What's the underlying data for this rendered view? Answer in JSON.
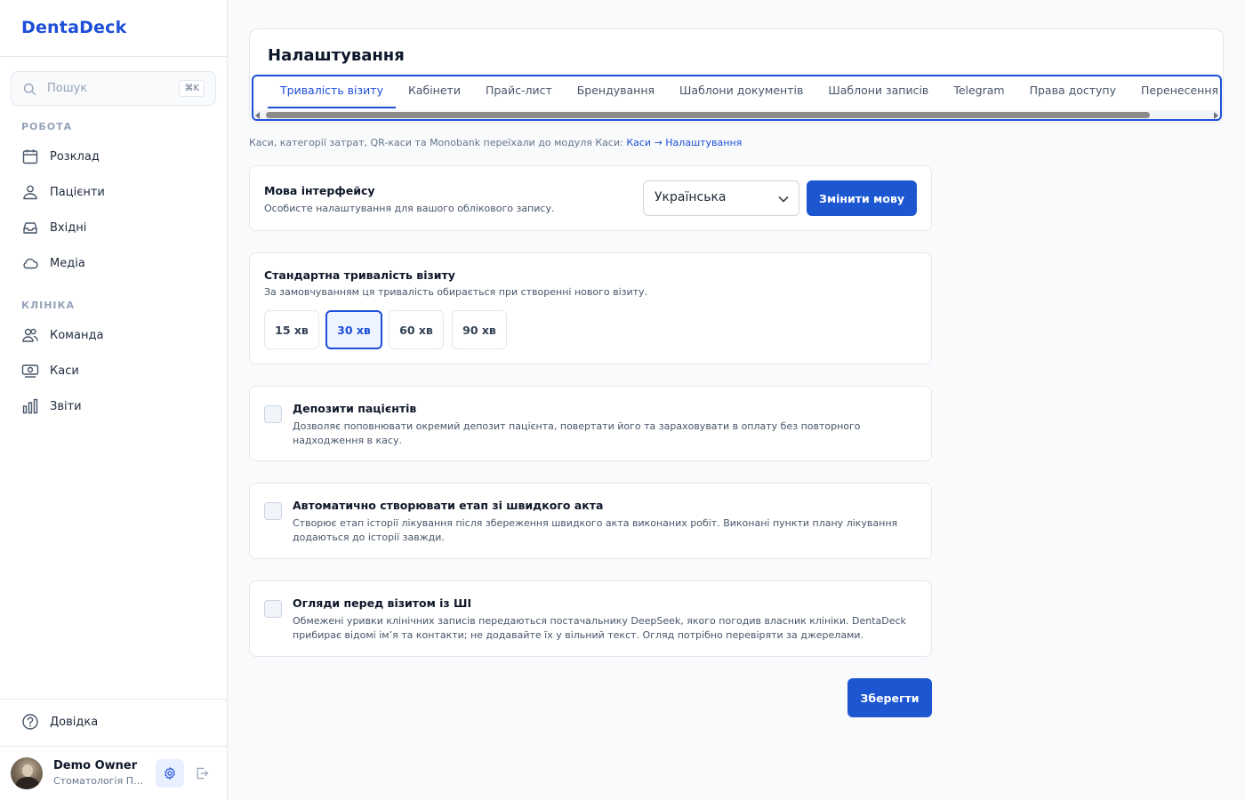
{
  "sidebar": {
    "brand": "DentaDeck",
    "search": {
      "placeholder": "Пошук",
      "shortcut": "⌘K"
    },
    "sections": [
      {
        "title": "РОБОТА",
        "items": [
          {
            "label": "Розклад",
            "icon": "calendar-icon"
          },
          {
            "label": "Пацієнти",
            "icon": "users-icon"
          },
          {
            "label": "Вхідні",
            "icon": "inbox-icon"
          },
          {
            "label": "Медіа",
            "icon": "cloud-icon"
          }
        ]
      },
      {
        "title": "КЛІНІКА",
        "items": [
          {
            "label": "Команда",
            "icon": "team-icon"
          },
          {
            "label": "Каси",
            "icon": "cash-icon"
          },
          {
            "label": "Звіти",
            "icon": "chart-icon"
          }
        ]
      }
    ],
    "help": {
      "label": "Довідка",
      "icon": "help-icon"
    },
    "user": {
      "name": "Demo Owner",
      "org": "Стоматологія Приклад"
    }
  },
  "header": {
    "title": "Налаштування",
    "tabs": [
      {
        "label": "Тривалість візиту",
        "active": true
      },
      {
        "label": "Кабінети"
      },
      {
        "label": "Прайс-лист"
      },
      {
        "label": "Брендування"
      },
      {
        "label": "Шаблони документів"
      },
      {
        "label": "Шаблони записів"
      },
      {
        "label": "Telegram"
      },
      {
        "label": "Права доступу"
      },
      {
        "label": "Перенесення з інших систем"
      }
    ]
  },
  "notice": {
    "text": "Каси, категорії затрат, QR-каси та Monobank переїхали до модуля Каси: ",
    "link": "Каси → Налаштування"
  },
  "language": {
    "title": "Мова інтерфейсу",
    "desc": "Особисте налаштування для вашого облікового запису.",
    "selected": "Українська",
    "button": "Змінити мову"
  },
  "duration": {
    "title": "Стандартна тривалість візиту",
    "desc": "За замовчуванням ця тривалість обирається при створенні нового візиту.",
    "options": [
      "15 хв",
      "30 хв",
      "60 хв",
      "90 хв"
    ],
    "selected": "30 хв"
  },
  "toggles": [
    {
      "title": "Депозити пацієнтів",
      "desc": "Дозволяє поповнювати окремий депозит пацієнта, повертати його та зараховувати в оплату без повторного надходження в касу.",
      "checked": false
    },
    {
      "title": "Автоматично створювати етап зі швидкого акта",
      "desc": "Створює етап історії лікування після збереження швидкого акта виконаних робіт. Виконані пункти плану лікування додаються до історії завжди.",
      "checked": false
    },
    {
      "title": "Огляди перед візитом із ШІ",
      "desc": "Обмежені уривки клінічних записів передаються постачальнику DeepSeek, якого погодив власник клініки. DentaDeck прибирає відомі ім’я та контакти; не додавайте їх у вільний текст. Огляд потрібно перевіряти за джерелами.",
      "checked": false
    }
  ],
  "save_label": "Зберегти",
  "colors": {
    "accent": "#1d4ed8",
    "button": "#1d56d1"
  }
}
